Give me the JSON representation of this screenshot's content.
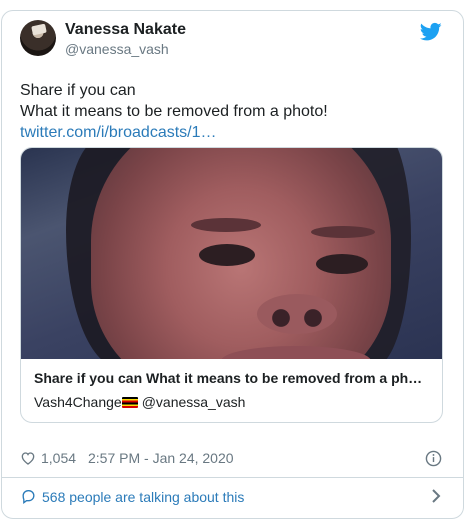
{
  "tweet": {
    "author_name": "Vanessa Nakate",
    "author_handle": "@vanessa_vash",
    "text_line1": "Share if you can",
    "text_line2": "What it means to be removed from a photo!",
    "link_text": "twitter.com/i/broadcasts/1…",
    "likes": "1,054",
    "timestamp": "2:57 PM - Jan 24, 2020",
    "talking": "568 people are talking about this"
  },
  "media_card": {
    "title": "Share if you can What it means to be removed from a ph…",
    "source_name": "Vash4Change",
    "source_handle": "@vanessa_vash"
  },
  "icons": {
    "brand": "twitter-bird-icon",
    "like": "heart-icon",
    "info": "info-icon",
    "reply": "speech-bubble-icon",
    "more": "chevron-right-icon",
    "flag": "uganda-flag-icon"
  },
  "colors": {
    "link": "#2b7bb9",
    "twitter_blue": "#1da1f2",
    "muted": "#697882",
    "text": "#1c2022",
    "border": "#cfd9de"
  }
}
